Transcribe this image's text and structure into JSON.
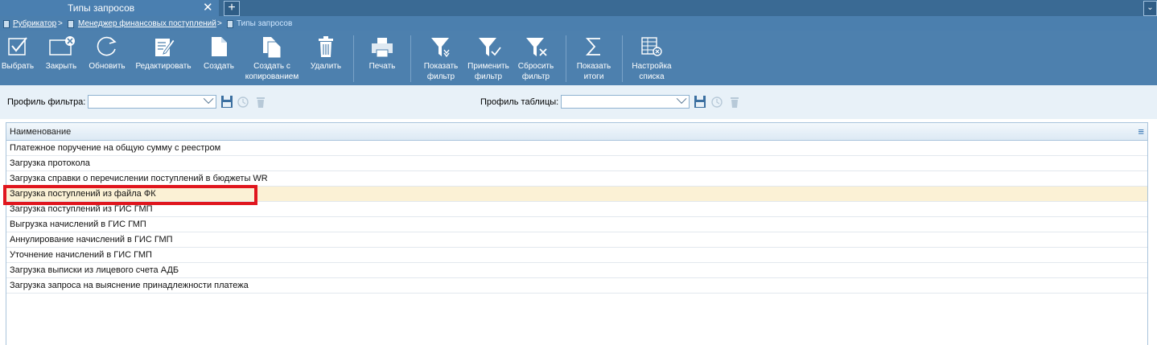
{
  "tab": {
    "title": "Типы запросов",
    "close": "✕",
    "add": "+"
  },
  "breadcrumb": {
    "items": [
      "Рубрикатор",
      "Менеджер финансовых поступлений",
      "Типы запросов"
    ],
    "sep": ">"
  },
  "toolbar": {
    "select": "Выбрать",
    "close": "Закрыть",
    "refresh": "Обновить",
    "edit": "Редактировать",
    "create": "Создать",
    "copy": "Создать с копированием",
    "delete": "Удалить",
    "print": "Печать",
    "show_filter": "Показать фильтр",
    "apply_filter": "Применить фильтр",
    "reset_filter": "Сбросить фильтр",
    "show_totals": "Показать итоги",
    "list_settings": "Настройка списка"
  },
  "filters": {
    "filter_profile_label": "Профиль фильтра:",
    "table_profile_label": "Профиль таблицы:",
    "filter_profile_value": "",
    "table_profile_value": ""
  },
  "grid": {
    "column": "Наименование",
    "rows": [
      "Платежное поручение на общую сумму с реестром",
      "Загрузка протокола",
      "Загрузка справки о перечислении поступлений в бюджеты WR",
      "Загрузка поступлений из файла ФК",
      "Загрузка поступлений из ГИС ГМП",
      "Выгрузка начислений в ГИС ГМП",
      "Аннулирование начислений в ГИС ГМП",
      "Уточнение начислений в ГИС ГМП",
      "Загрузка выписки из лицевого счета АДБ",
      "Загрузка запроса на выяснение принадлежности платежа"
    ],
    "selected_index": 3
  },
  "colors": {
    "toolbar": "#4d80ae",
    "highlight": "#e0161e",
    "selected_row": "#fbf1d5"
  }
}
